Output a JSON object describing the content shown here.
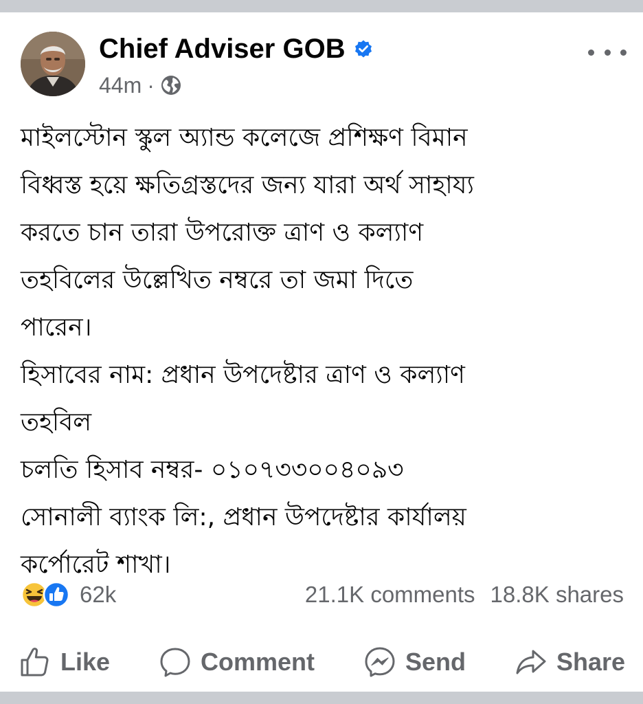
{
  "post": {
    "author": "Chief Adviser GOB",
    "time": "44m",
    "separator": "·",
    "privacy_icon": "globe-icon",
    "verified_icon": "verified-badge-icon",
    "more_icon": "more-options-icon",
    "body_lines": [
      "মাইলস্টোন স্কুল অ্যান্ড কলেজে প্রশিক্ষণ বিমান",
      "বিধ্বস্ত হয়ে ক্ষতিগ্রস্তদের জন্য যারা অর্থ সাহায্য",
      "করতে চান তারা উপরোক্ত ত্রাণ ও কল্যাণ",
      "তহবিলের উল্লেখিত নম্বরে তা জমা দিতে",
      "পারেন।",
      "হিসাবের নাম: প্রধান উপদেষ্টার ত্রাণ ও কল্যাণ",
      "তহবিল",
      "চলতি হিসাব নম্বর- ০১০৭৩৩০০৪০৯৩",
      "সোনালী ব্যাংক লি:, প্রধান উপদেষ্টার কার্যালয়",
      "কর্পোরেট শাখা।"
    ]
  },
  "stats": {
    "reaction_icons": [
      "haha-reaction-icon",
      "like-reaction-icon"
    ],
    "reactions": "62k",
    "comments": "21.1K comments",
    "shares": "18.8K shares"
  },
  "actions": {
    "like": "Like",
    "comment": "Comment",
    "send": "Send",
    "share": "Share"
  },
  "colors": {
    "text_primary": "#050505",
    "text_secondary": "#65676b",
    "verified_blue": "#1877f2",
    "background": "#ffffff",
    "separator_bar": "#c9ccd1"
  }
}
